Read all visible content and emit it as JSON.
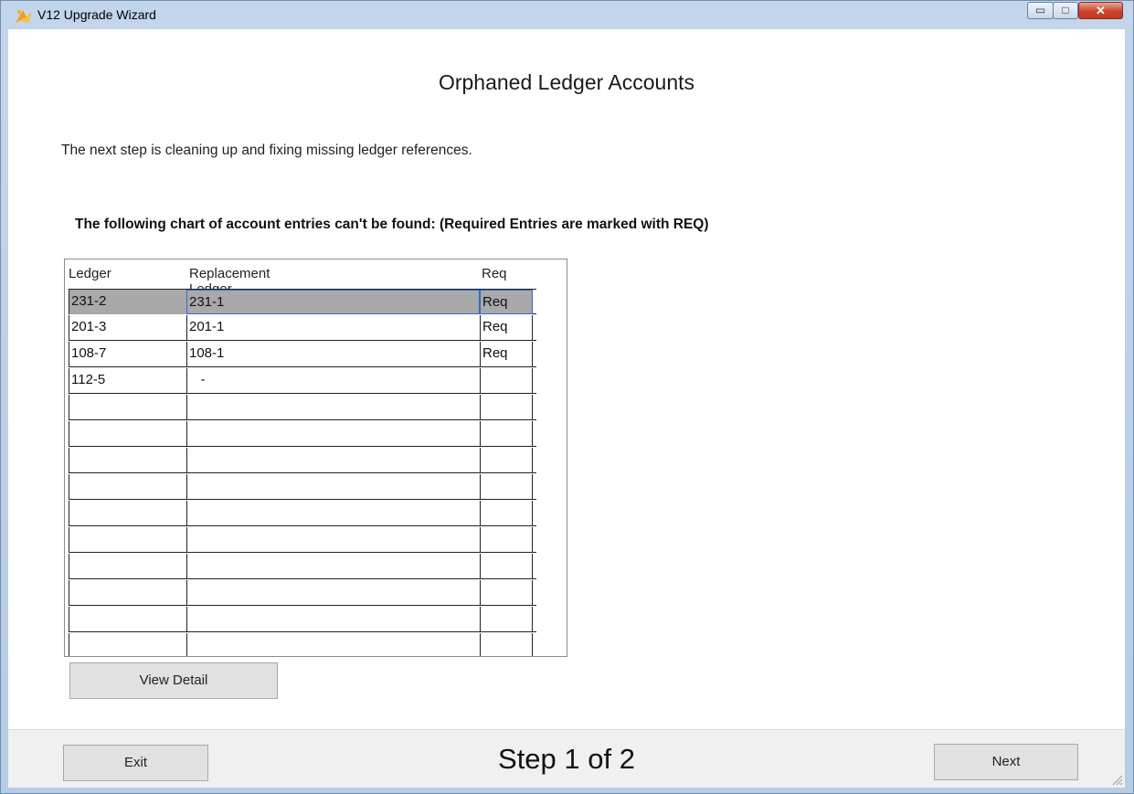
{
  "window": {
    "title": "V12 Upgrade Wizard",
    "close_glyph": "✕"
  },
  "page": {
    "title": "Orphaned Ledger Accounts",
    "description": "The next step is cleaning up and fixing missing ledger references.",
    "chart_label": "The following chart of account entries can't be found: (Required Entries are marked with REQ)"
  },
  "grid": {
    "headers": {
      "ledger": "Ledger",
      "replacement": "Replacement Ledger",
      "req": "Req"
    },
    "rows": [
      {
        "ledger": "231-2",
        "replacement": "231-1",
        "req": "Req"
      },
      {
        "ledger": "201-3",
        "replacement": "201-1",
        "req": "Req"
      },
      {
        "ledger": "108-7",
        "replacement": "108-1",
        "req": "Req"
      },
      {
        "ledger": "112-5",
        "replacement": "   -",
        "req": ""
      },
      {
        "ledger": "",
        "replacement": "",
        "req": ""
      },
      {
        "ledger": "",
        "replacement": "",
        "req": ""
      },
      {
        "ledger": "",
        "replacement": "",
        "req": ""
      },
      {
        "ledger": "",
        "replacement": "",
        "req": ""
      },
      {
        "ledger": "",
        "replacement": "",
        "req": ""
      },
      {
        "ledger": "",
        "replacement": "",
        "req": ""
      },
      {
        "ledger": "",
        "replacement": "",
        "req": ""
      },
      {
        "ledger": "",
        "replacement": "",
        "req": ""
      },
      {
        "ledger": "",
        "replacement": "",
        "req": ""
      },
      {
        "ledger": "",
        "replacement": "",
        "req": ""
      }
    ],
    "selected_row": 0
  },
  "buttons": {
    "view_detail": "View Detail",
    "exit": "Exit",
    "next": "Next"
  },
  "footer": {
    "step": "Step 1 of 2"
  },
  "icons": {
    "app": "wizard-hat-icon",
    "scroll_up": "chevron-up-icon",
    "scroll_down": "chevron-down-icon"
  }
}
